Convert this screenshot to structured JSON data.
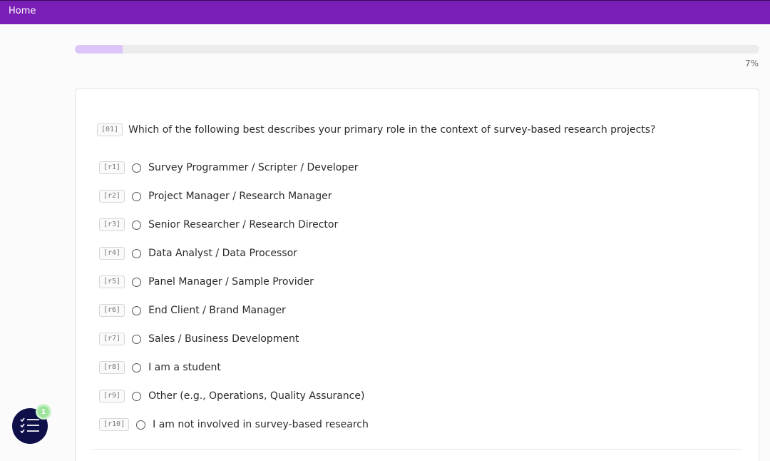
{
  "topbar": {
    "home_label": "Home",
    "color": "#7a1fb5"
  },
  "progress": {
    "percent": 7,
    "label": "7%"
  },
  "question": {
    "tag": "[01]",
    "text": "Which of the following best describes your primary role in the context of survey-based research projects?"
  },
  "options": [
    {
      "tag": "[r1]",
      "label": "Survey Programmer / Scripter / Developer"
    },
    {
      "tag": "[r2]",
      "label": "Project Manager / Research Manager"
    },
    {
      "tag": "[r3]",
      "label": "Senior Researcher / Research Director"
    },
    {
      "tag": "[r4]",
      "label": "Data Analyst / Data Processor"
    },
    {
      "tag": "[r5]",
      "label": "Panel Manager / Sample Provider"
    },
    {
      "tag": "[r6]",
      "label": "End Client / Brand Manager"
    },
    {
      "tag": "[r7]",
      "label": "Sales / Business Development"
    },
    {
      "tag": "[r8]",
      "label": "I am a student"
    },
    {
      "tag": "[r9]",
      "label": "Other (e.g., Operations, Quality Assurance)"
    },
    {
      "tag": "[r10]",
      "label": "I am not involved in survey-based research"
    }
  ],
  "fab": {
    "icon": "checklist-icon",
    "badge_count": "1"
  }
}
